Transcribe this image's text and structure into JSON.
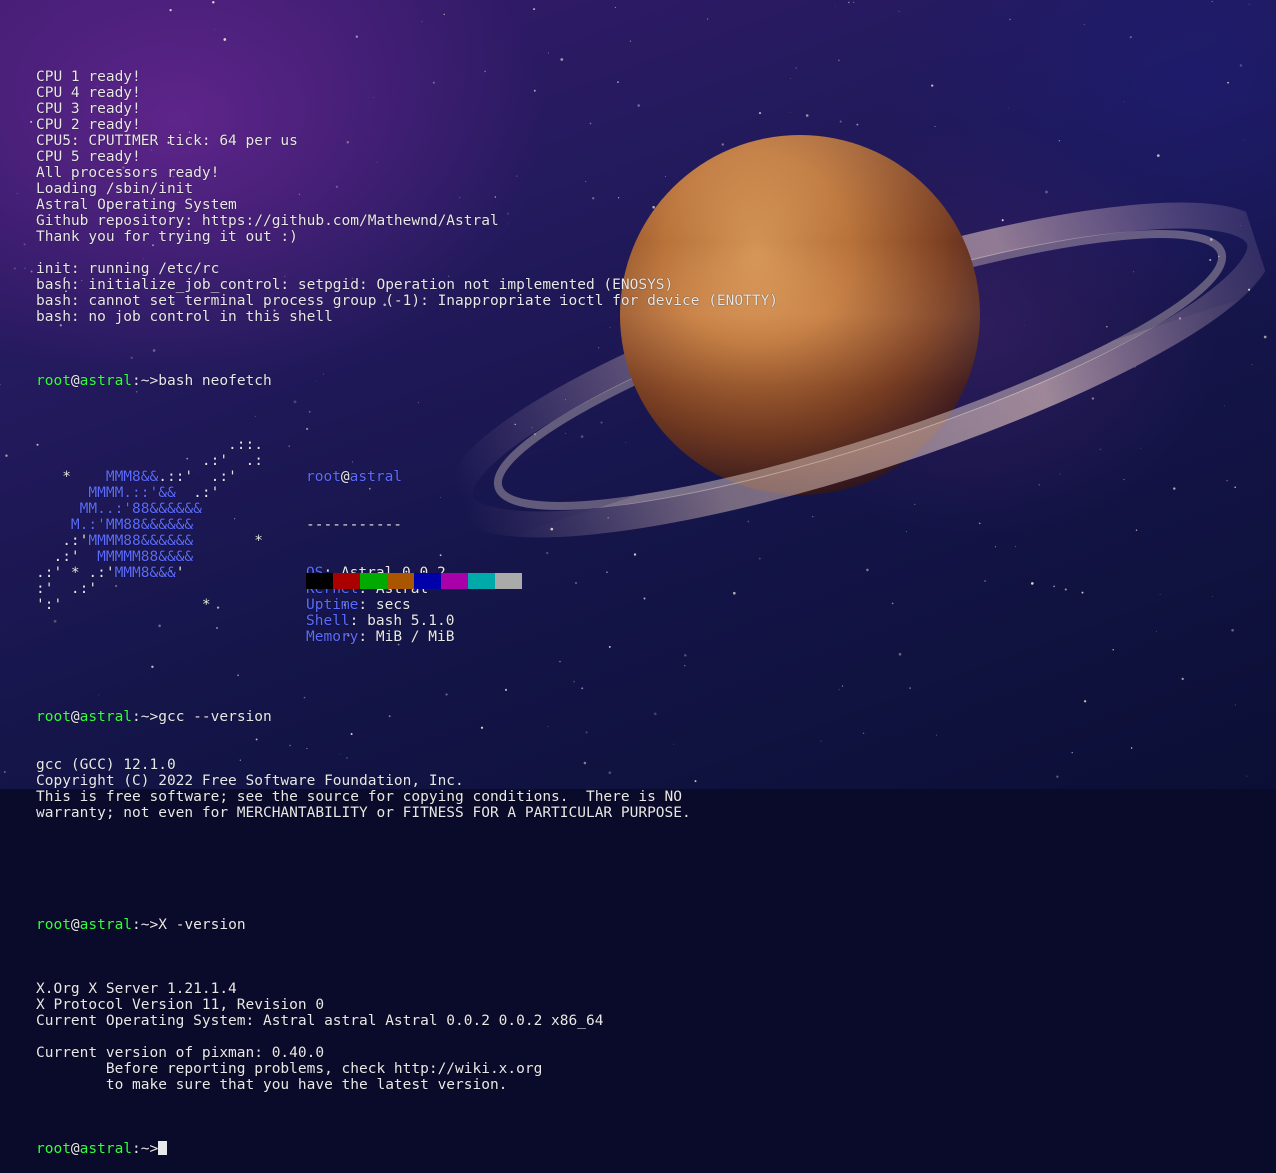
{
  "boot_lines": [
    "CPU 1 ready!",
    "CPU 4 ready!",
    "CPU 3 ready!",
    "CPU 2 ready!",
    "CPU5: CPUTIMER tick: 64 per us",
    "CPU 5 ready!",
    "All processors ready!",
    "Loading /sbin/init",
    "Astral Operating System",
    "Github repository: https://github.com/Mathewnd/Astral",
    "Thank you for trying it out :)",
    "",
    "init: running /etc/rc",
    "bash: initialize_job_control: setpgid: Operation not implemented (ENOSYS)",
    "bash: cannot set terminal process group (-1): Inappropriate ioctl for device (ENOTTY)",
    "bash: no job control in this shell"
  ],
  "prompt": {
    "user": "root",
    "at": "@",
    "host": "astral",
    "path": ":~>"
  },
  "commands": {
    "neofetch": "bash neofetch",
    "gcc": "gcc --version",
    "x": "X -version"
  },
  "neofetch": {
    "logo_lines": [
      "                      .::.",
      "                   .:'  .:",
      "   *    MMM8&&.::'  .:'",
      "      MMMM.::'&&  .:'",
      "     MM..:'88&&&&&&",
      "    M.:'MM88&&&&&&",
      "   .:'MMMM88&&&&&&       *",
      "  .:'  MMMMM88&&&&",
      ".:' * .:'MMM8&&&'",
      ":'  .:'",
      "':'                *"
    ],
    "user_host": {
      "user": "root",
      "at": "@",
      "host": "astral"
    },
    "separator": "-----------",
    "fields": [
      {
        "key": "OS",
        "value": "Astral 0.0.2"
      },
      {
        "key": "Kernel",
        "value": "Astral"
      },
      {
        "key": "Uptime",
        "value": "secs"
      },
      {
        "key": "Shell",
        "value": "bash 5.1.0"
      },
      {
        "key": "Memory",
        "value": "MiB / MiB"
      }
    ],
    "palette": [
      "#000000",
      "#aa0000",
      "#00aa00",
      "#aa5500",
      "#0000aa",
      "#aa00aa",
      "#00aaaa",
      "#aaaaaa"
    ]
  },
  "gcc_output": [
    "gcc (GCC) 12.1.0",
    "Copyright (C) 2022 Free Software Foundation, Inc.",
    "This is free software; see the source for copying conditions.  There is NO",
    "warranty; not even for MERCHANTABILITY or FITNESS FOR A PARTICULAR PURPOSE."
  ],
  "x_output": [
    "",
    "X.Org X Server 1.21.1.4",
    "X Protocol Version 11, Revision 0",
    "Current Operating System: Astral astral Astral 0.0.2 0.0.2 x86_64",
    "",
    "Current version of pixman: 0.40.0",
    "        Before reporting problems, check http://wiki.x.org",
    "        to make sure that you have the latest version."
  ]
}
